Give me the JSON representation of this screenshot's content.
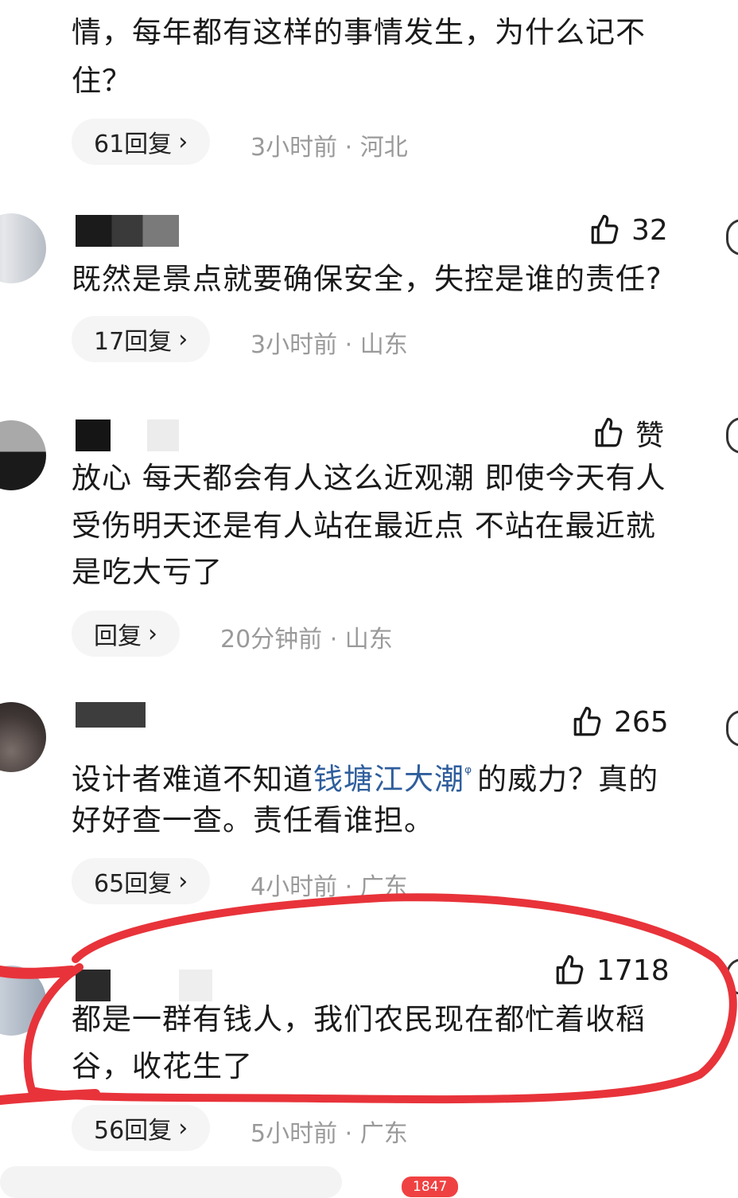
{
  "comments": [
    {
      "lines": [
        "情，每年都有这样的事情发生，为什么记不",
        "住？"
      ],
      "replies": "61回复",
      "time_loc": "3小时前 · 河北"
    },
    {
      "likes": "32",
      "lines": [
        "既然是景点就要确保安全，失控是谁的责任?"
      ],
      "replies": "17回复",
      "time_loc": "3小时前 · 山东"
    },
    {
      "likes": "赞",
      "lines": [
        "放心 每天都会有人这么近观潮 即使今天有人",
        "受伤明天还是有人站在最近点 不站在最近就",
        "是吃大亏了"
      ],
      "replies": "回复",
      "time_loc": "20分钟前 · 山东"
    },
    {
      "likes": "265",
      "line1_before": "设计者难道不知道",
      "line1_link": "钱塘江大潮",
      "line1_after": "的威力？真的",
      "line2": "好好查一查。责任看谁担。",
      "replies": "65回复",
      "time_loc": "4小时前 · 广东"
    },
    {
      "likes": "1718",
      "lines": [
        "都是一群有钱人，我们农民现在都忙着收稻",
        "谷，收花生了"
      ],
      "replies": "56回复",
      "time_loc": "5小时前 · 广东"
    }
  ],
  "bottom_bar": {
    "comment_count_badge": "1847"
  },
  "colors": {
    "annotation": "#e8333a",
    "link": "#2f5e9c",
    "pill_bg": "#f5f5f5",
    "meta": "#9a9a9a"
  },
  "icons": {
    "like": "thumbs-up-icon",
    "chevron": "chevron-right-icon",
    "search": "search-icon"
  }
}
